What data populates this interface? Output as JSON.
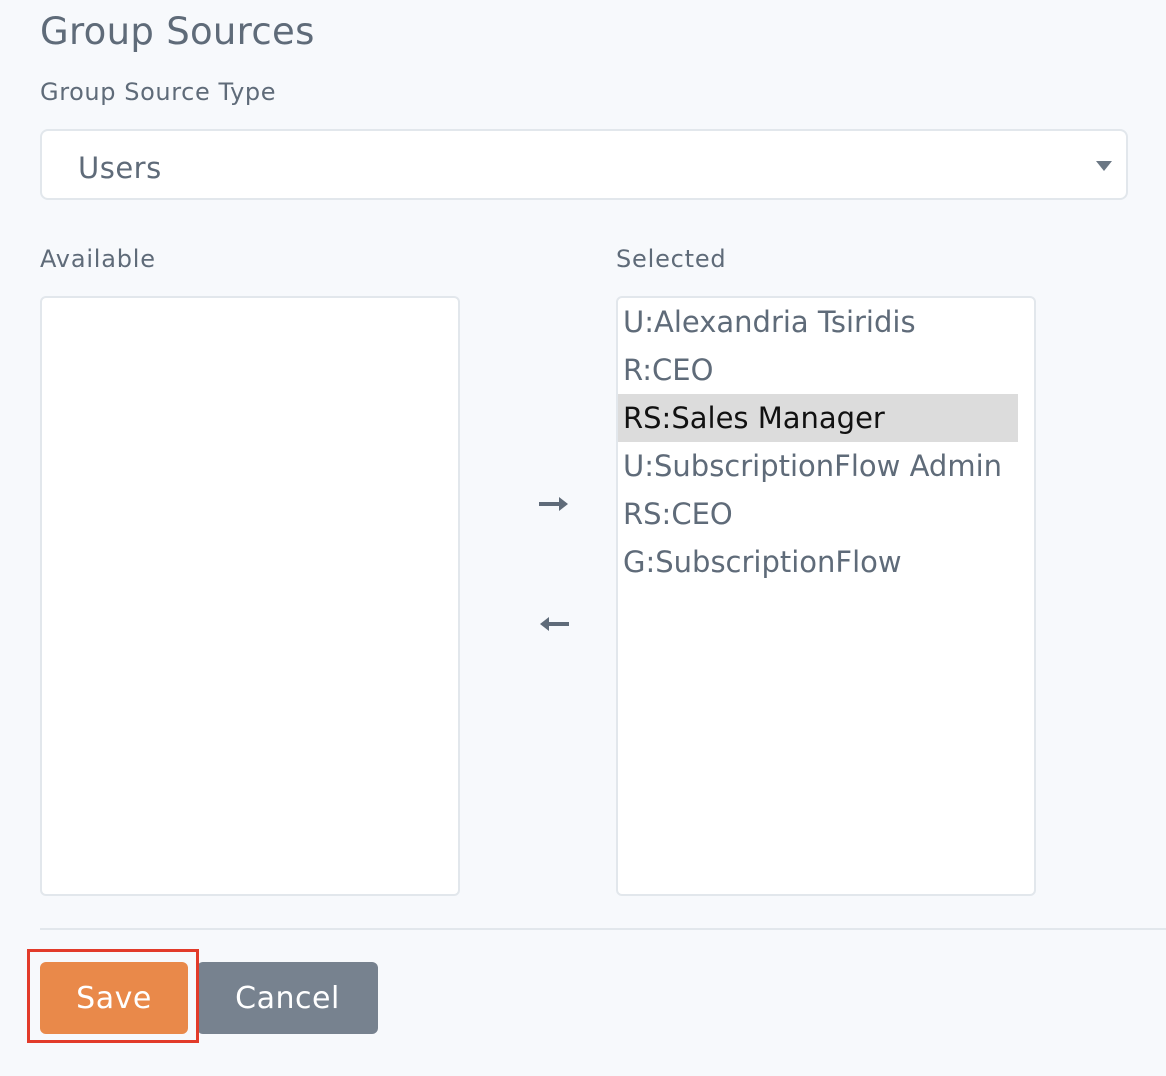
{
  "title": "Group Sources",
  "group_source_type": {
    "label": "Group Source Type",
    "selected_value": "Users"
  },
  "available": {
    "label": "Available",
    "items": []
  },
  "selected": {
    "label": "Selected",
    "items": [
      {
        "text": "U:Alexandria Tsiridis",
        "highlighted": false
      },
      {
        "text": "R:CEO",
        "highlighted": false
      },
      {
        "text": "RS:Sales Manager",
        "highlighted": true
      },
      {
        "text": "U:SubscriptionFlow Admin",
        "highlighted": false
      },
      {
        "text": "RS:CEO",
        "highlighted": false
      },
      {
        "text": "G:SubscriptionFlow",
        "highlighted": false
      }
    ]
  },
  "icons": {
    "move_right": "arrow-right-icon",
    "move_left": "arrow-left-icon",
    "dropdown": "caret-down-icon"
  },
  "buttons": {
    "save_label": "Save",
    "cancel_label": "Cancel"
  },
  "colors": {
    "save": "#e9894a",
    "cancel": "#77828f",
    "highlight_frame": "#e23b2a",
    "selected_row": "#dcdcdc"
  }
}
